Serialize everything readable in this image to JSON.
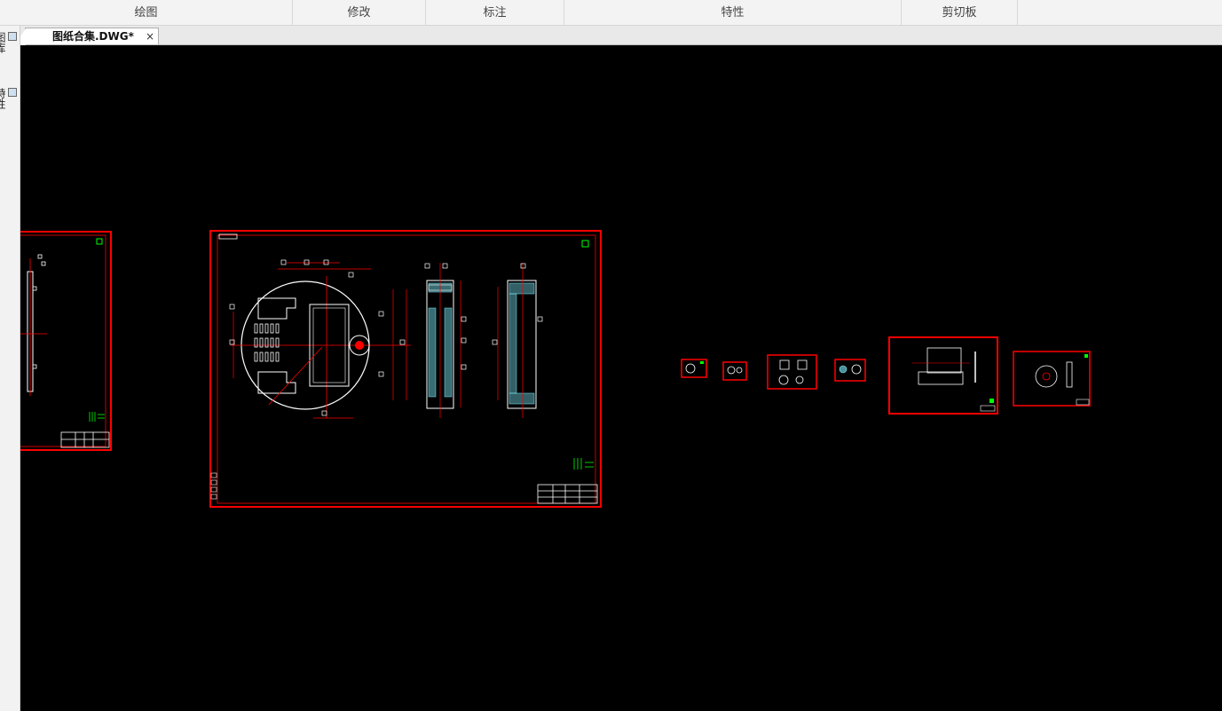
{
  "ribbon": {
    "groups": [
      "绘图",
      "修改",
      "标注",
      "特性",
      "剪切板"
    ]
  },
  "tabs": [
    {
      "label": "图纸合集.DWG*",
      "close": "×"
    }
  ],
  "sidebar": {
    "items": [
      {
        "label": "图库",
        "icon": "library-icon"
      },
      {
        "label": "特性",
        "icon": "properties-icon"
      }
    ]
  },
  "colors": {
    "canvas_background": "#000000",
    "frame_red": "#ff0000",
    "geometry_white": "#ffffff",
    "hatch_cyan": "#7ff0ff",
    "marker_green": "#00ff00"
  }
}
